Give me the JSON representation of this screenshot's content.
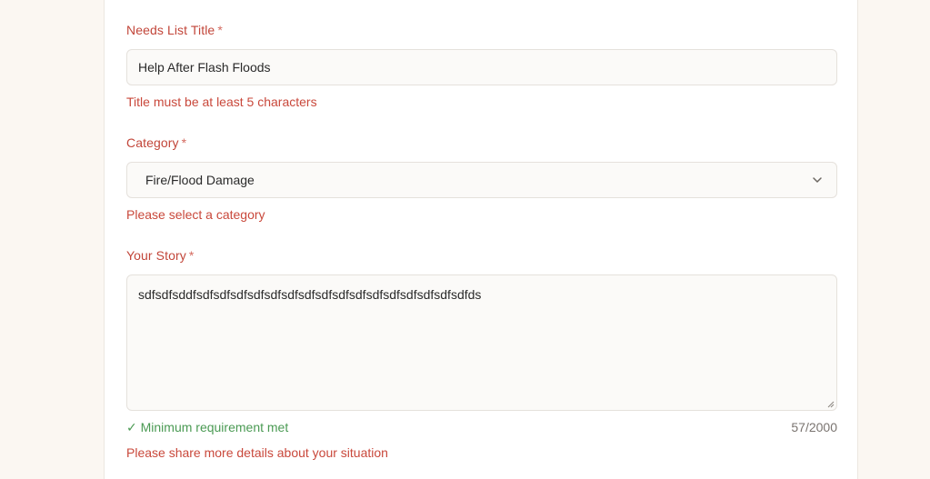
{
  "form": {
    "title_field": {
      "label": "Needs List Title",
      "required_mark": "*",
      "value": "Help After Flash Floods",
      "error": "Title must be at least 5 characters"
    },
    "category_field": {
      "label": "Category",
      "required_mark": "*",
      "selected": "Fire/Flood Damage",
      "error": "Please select a category"
    },
    "story_field": {
      "label": "Your Story",
      "required_mark": "*",
      "value": "sdfsdfsddfsdfsdfsdfsdfsdfsdfsdfsdfsdfsdfsdfsdfsdfsdfsdfsdfds",
      "status": "✓ Minimum requirement met",
      "counter": "57/2000",
      "error": "Please share more details about your situation"
    }
  },
  "colors": {
    "error": "#c9483b",
    "success": "#4a9a53",
    "background": "#fbf7f2"
  },
  "icons": {
    "select_chevron": "chevron-down-icon",
    "textarea_resize": "resize-handle-icon"
  }
}
